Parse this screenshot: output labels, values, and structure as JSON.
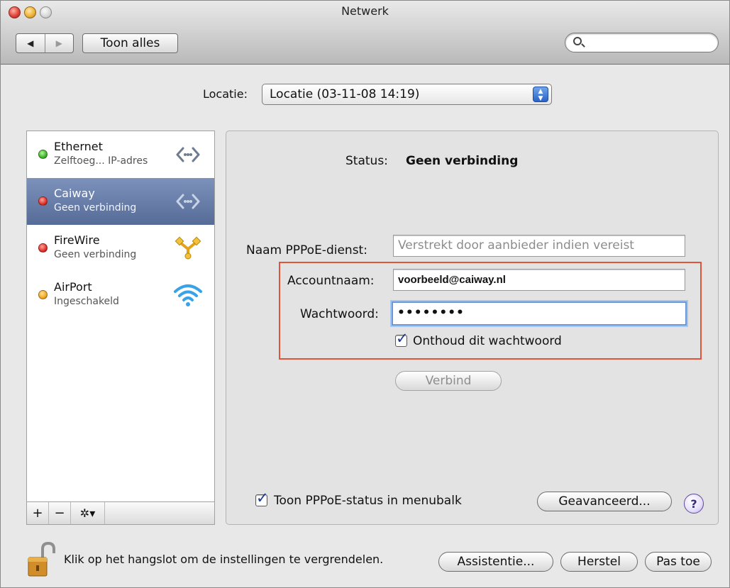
{
  "window": {
    "title": "Netwerk"
  },
  "toolbar": {
    "back_glyph": "◀",
    "forward_glyph": "▶",
    "show_all_label": "Toon alles",
    "search_placeholder": ""
  },
  "location": {
    "label": "Locatie:",
    "selected": "Locatie (03-11-08 14:19)"
  },
  "services": [
    {
      "name": "Ethernet",
      "status": "Zelftoeg... IP-adres",
      "dot": "green",
      "icon": "ethernet-icon",
      "selected": false
    },
    {
      "name": "Caiway",
      "status": "Geen verbinding",
      "dot": "red",
      "icon": "ethernet-icon",
      "selected": true
    },
    {
      "name": "FireWire",
      "status": "Geen verbinding",
      "dot": "red",
      "icon": "firewire-icon",
      "selected": false
    },
    {
      "name": "AirPort",
      "status": "Ingeschakeld",
      "dot": "yellow",
      "icon": "airport-icon",
      "selected": false
    }
  ],
  "service_footer": {
    "add": "+",
    "remove": "−",
    "action": "✲▾"
  },
  "detail": {
    "status_label": "Status:",
    "status_value": "Geen verbinding",
    "pppoe_service_label": "Naam PPPoE-dienst:",
    "pppoe_service_placeholder": "Verstrekt door aanbieder indien vereist",
    "account_label": "Accountnaam:",
    "account_value": "voorbeeld@caiway.nl",
    "password_label": "Wachtwoord:",
    "password_value": "••••••••",
    "remember_label": "Onthoud dit wachtwoord",
    "remember_checked": true,
    "connect_label": "Verbind",
    "show_status_label": "Toon PPPoE-status in menubalk",
    "show_status_checked": true,
    "advanced_label": "Geavanceerd...",
    "help_label": "?"
  },
  "footer": {
    "lock_text": "Klik op het hangslot om de instellingen te vergrendelen.",
    "assist_label": "Assistentie...",
    "revert_label": "Herstel",
    "apply_label": "Pas toe"
  },
  "colors": {
    "selection": "#6a80ab",
    "highlight_border": "#e0553a",
    "checkbox_tick": "#1a3c8a"
  }
}
